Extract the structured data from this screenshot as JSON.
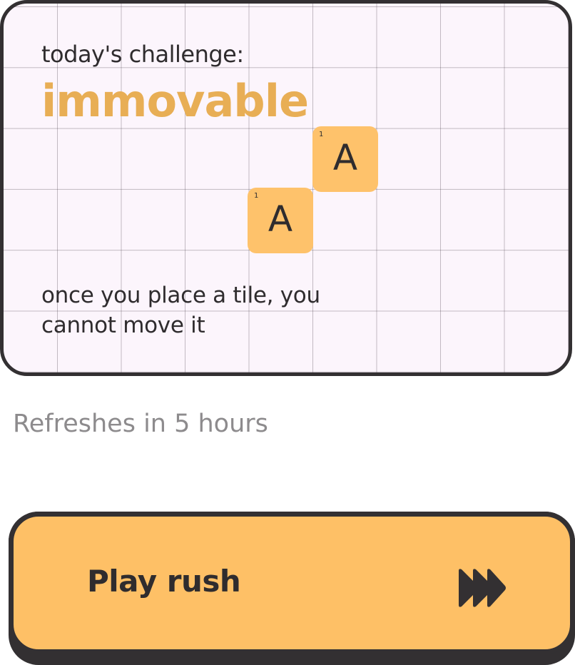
{
  "challenge": {
    "label": "today's challenge:",
    "name": "immovable",
    "description": "once you place a tile, you cannot move it",
    "tiles": [
      {
        "letter": "A",
        "score": "1"
      },
      {
        "letter": "A",
        "score": "1"
      }
    ]
  },
  "refresh": {
    "text": "Refreshes in 5 hours"
  },
  "play_button": {
    "label": "Play rush",
    "icon": "fast-forward-icon"
  },
  "colors": {
    "accent": "#e8ae55",
    "tile": "#fec26b",
    "button": "#fec066",
    "dark": "#333032",
    "card_bg": "#fcf5fc",
    "muted_text": "#8d8b8d"
  }
}
